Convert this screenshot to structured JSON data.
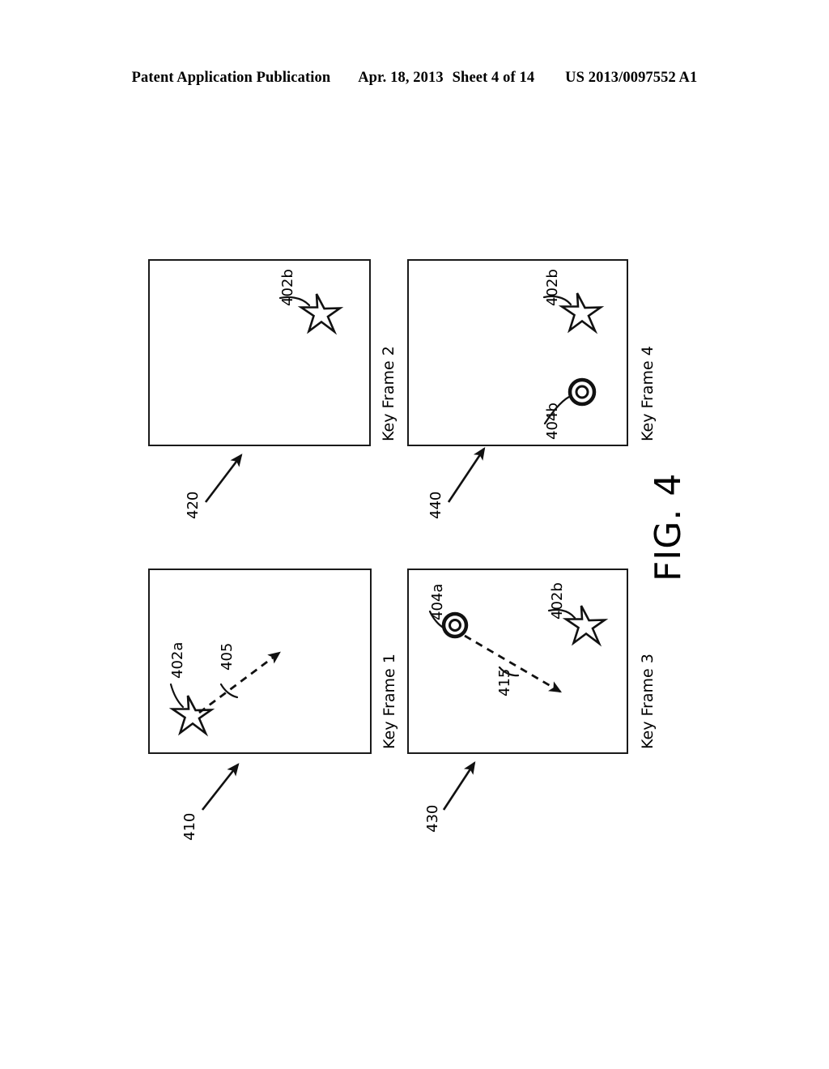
{
  "header": {
    "publication": "Patent Application Publication",
    "date": "Apr. 18, 2013",
    "sheet": "Sheet 4 of 14",
    "patent_number": "US 2013/0097552 A1"
  },
  "figure": {
    "label": "FIG. 4",
    "frames": [
      {
        "id": "frame-2",
        "caption": "Key Frame 2",
        "ref_number": "420",
        "objects": [
          {
            "type": "star",
            "label": "402b"
          }
        ]
      },
      {
        "id": "frame-4",
        "caption": "Key Frame 4",
        "ref_number": "440",
        "objects": [
          {
            "type": "star",
            "label": "402b"
          },
          {
            "type": "circle",
            "label": "404b"
          }
        ]
      },
      {
        "id": "frame-1",
        "caption": "Key Frame 1",
        "ref_number": "410",
        "objects": [
          {
            "type": "star",
            "label": "402a"
          },
          {
            "type": "motion-arrow",
            "label": "405"
          }
        ]
      },
      {
        "id": "frame-3",
        "caption": "Key Frame 3",
        "ref_number": "430",
        "objects": [
          {
            "type": "circle",
            "label": "404a"
          },
          {
            "type": "motion-arrow",
            "label": "415"
          },
          {
            "type": "star",
            "label": "402b"
          }
        ]
      }
    ]
  },
  "colors": {
    "line": "#1a1a1a",
    "background": "#ffffff"
  }
}
